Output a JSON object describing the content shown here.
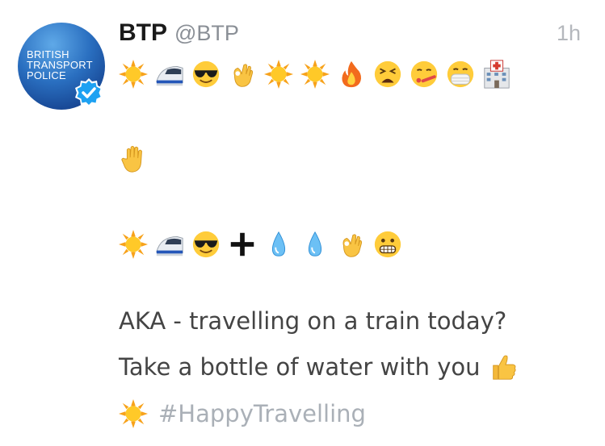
{
  "tweet": {
    "name": "BTP",
    "handle": "@BTP",
    "time": "1h",
    "avatar": {
      "lines": [
        "BRITISH",
        "TRANSPORT",
        "POLICE"
      ],
      "verified_icon": "verified-badge-icon",
      "colors": {
        "top": "#5fa9e8",
        "bottom": "#0c2f7a",
        "badge": "#1da1f2"
      }
    },
    "row1": [
      "sun",
      "train",
      "sunglasses-face",
      "ok-hand",
      "sun",
      "sun",
      "fire",
      "tired-face",
      "thermometer-face",
      "mask-face",
      "hospital"
    ],
    "row2": [
      "raised-hand"
    ],
    "row3": [
      "sun",
      "train",
      "sunglasses-face",
      "plus",
      "droplet",
      "droplet",
      "ok-hand",
      "grimacing-face"
    ],
    "line1": "AKA - travelling on a train today?",
    "line2": "Take a bottle of water with you",
    "line2_emoji": "thumbs-up",
    "hashtag_emoji": "sun",
    "hashtag": "#HappyTravelling"
  }
}
